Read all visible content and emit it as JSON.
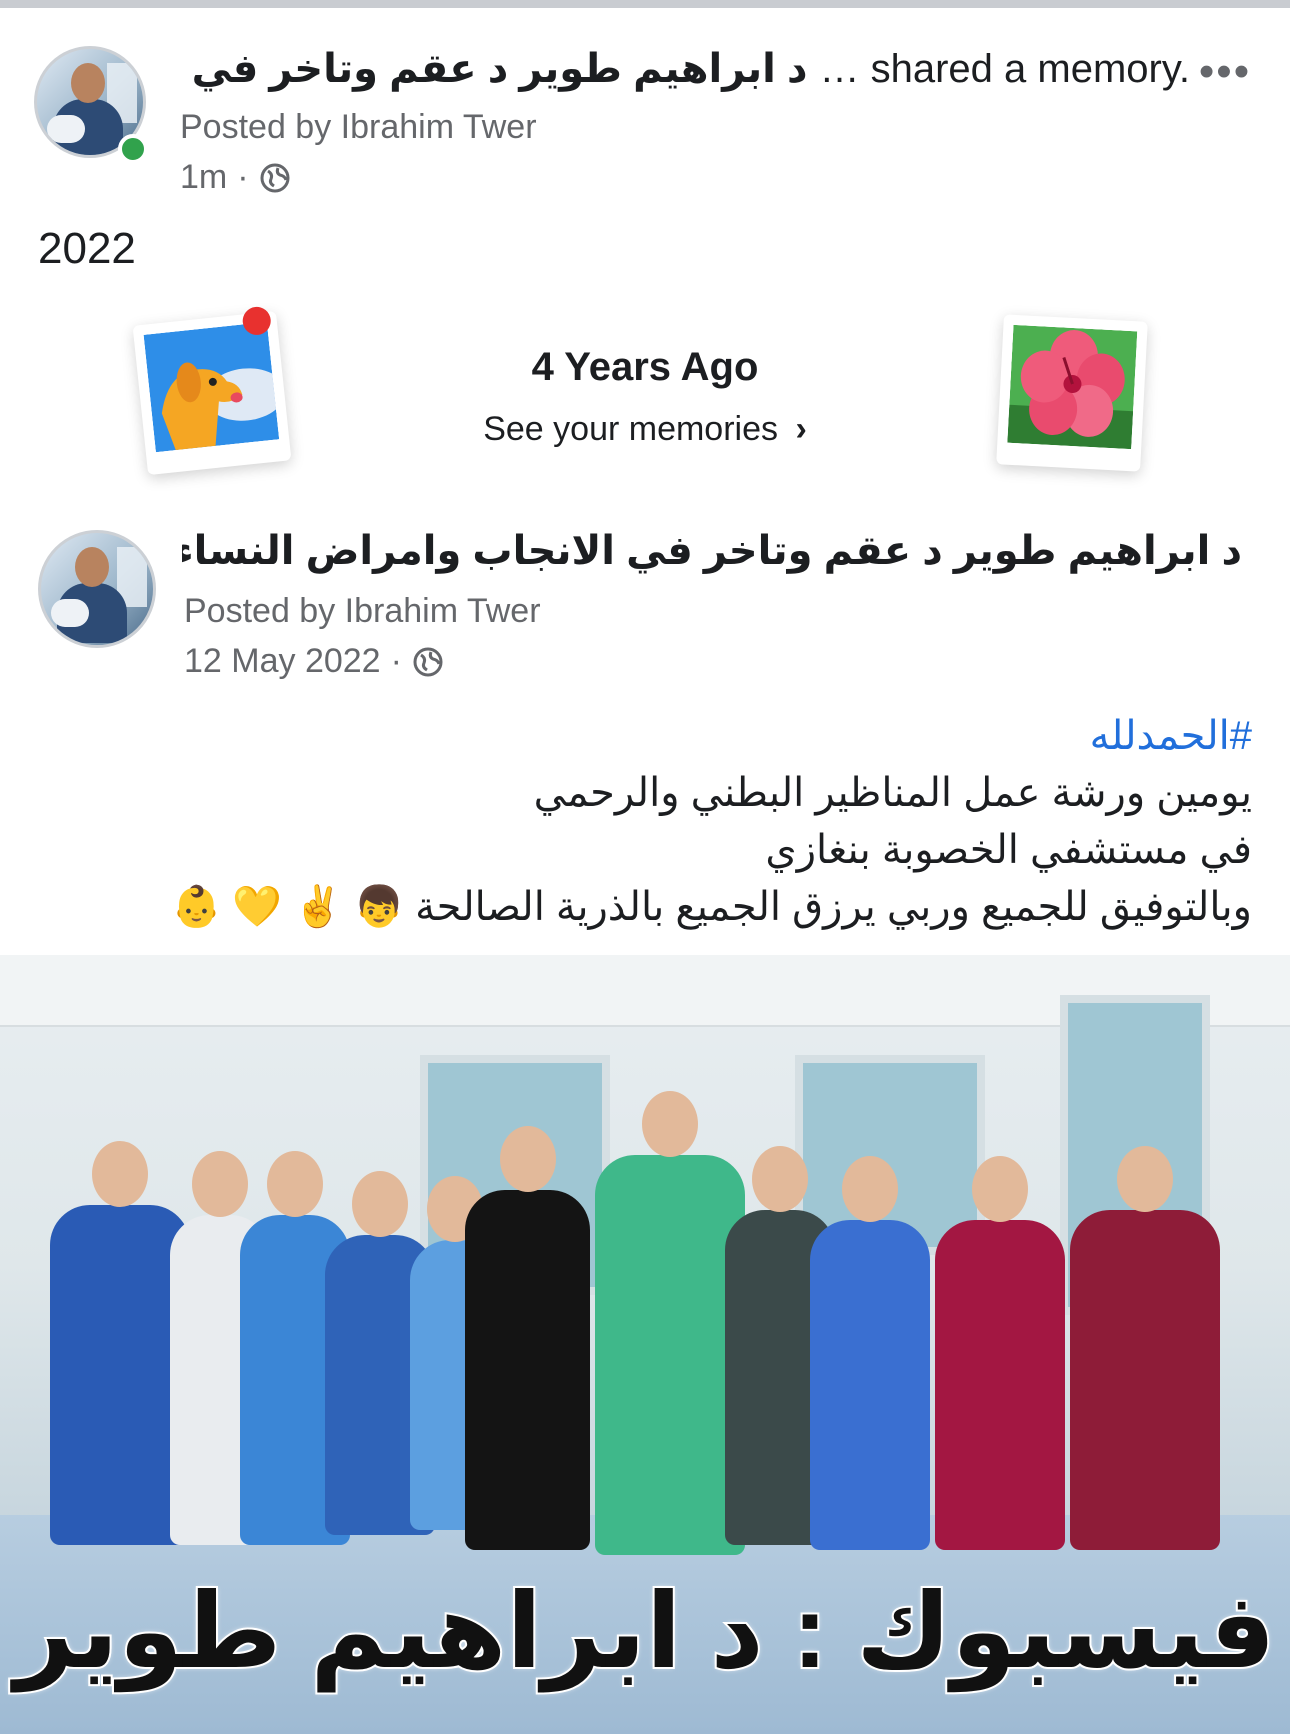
{
  "post1": {
    "author_ar": "د ابراهيم طوير د عقم وتاخر في",
    "action": "… shared a memory.",
    "more_label": "•••",
    "posted_by": "Posted by Ibrahim Twer",
    "time": "1m",
    "separator": "·",
    "year_text": "2022"
  },
  "memories": {
    "title": "4 Years Ago",
    "link": "See your memories",
    "chevron": "›"
  },
  "post2": {
    "author_ar": "د ابراهيم طوير د عقم وتاخر في الانجاب وامراض النساء و...",
    "posted_by": "Posted by Ibrahim Twer",
    "date": "12 May 2022",
    "separator": "·",
    "hashtag": "#الحمدلله",
    "line1": "يومين ورشة عمل المناظير البطني والرحمي",
    "line2": "في مستشفي الخصوبة بنغازي",
    "line3": "وبالتوفيق للجميع وربي يرزق الجميع بالذرية الصالحة 👦 ✌️ 💛 👶",
    "photo_watermark": "فيسبوك : د ابراهيم طوير"
  },
  "icons": {
    "globe": "globe-icon",
    "more": "more-icon",
    "dog": "dog-polaroid-icon",
    "flower": "flower-polaroid-icon"
  },
  "colors": {
    "online": "#31a24c",
    "hashtag": "#216fdb",
    "secondary_text": "#65676b"
  }
}
